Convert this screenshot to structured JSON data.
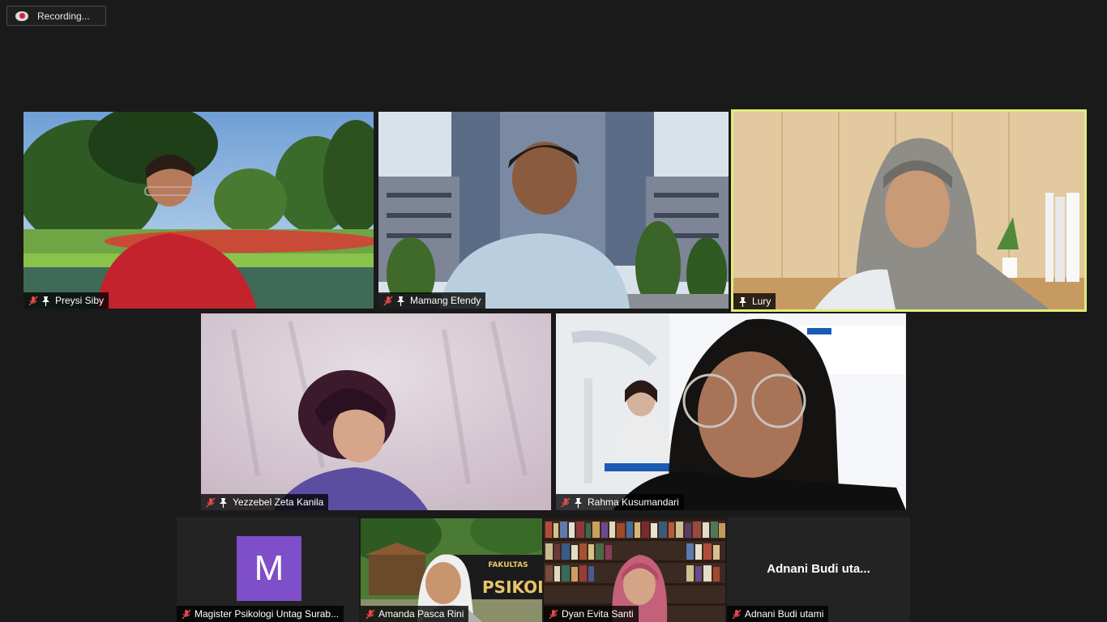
{
  "recording": {
    "label": "Recording...",
    "dot_color": "#d0243b"
  },
  "active_speaker_border": "#e1ec7a",
  "participants": [
    {
      "name": "Preysi Siby",
      "muted": true,
      "pinned_icon": true
    },
    {
      "name": "Mamang Efendy",
      "muted": true,
      "pinned_icon": true
    },
    {
      "name": "Lury",
      "muted": false,
      "pinned_icon": true,
      "active_speaker": true
    },
    {
      "name": "Yezzebel Zeta Kanila",
      "muted": true,
      "pinned_icon": true
    },
    {
      "name": "Rahma Kusumandari",
      "muted": true,
      "pinned_icon": true
    },
    {
      "name": "Magister Psikologi Untag Surab...",
      "muted": true,
      "avatar_letter": "M",
      "avatar_color": "#7f4ec9"
    },
    {
      "name": "Amanda Pasca Rini",
      "muted": true
    },
    {
      "name": "Dyan Evita Santi",
      "muted": true
    },
    {
      "name": "Adnani Budi utami",
      "muted": true,
      "video_off_label": "Adnani Budi uta..."
    }
  ],
  "backgrounds": {
    "building_sign": "FAKULTAS",
    "building_sign_2": "PSIKOLOGI"
  }
}
